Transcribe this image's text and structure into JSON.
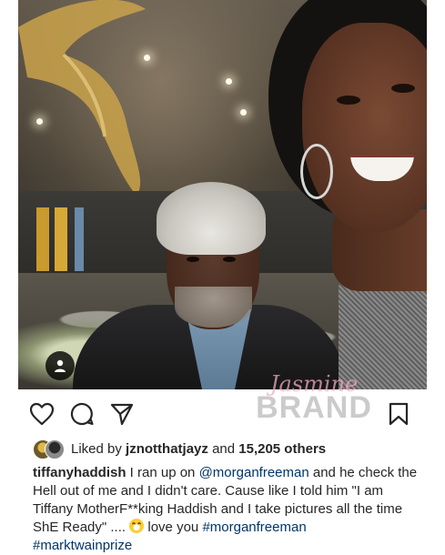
{
  "post": {
    "photo": {
      "alt": ""
    },
    "watermark": {
      "top": "Jasmine",
      "bottom": "BRAND"
    },
    "actions": {
      "like_icon": "heart-outline-icon",
      "comment_icon": "comment-bubble-icon",
      "share_icon": "paper-plane-icon",
      "save_icon": "bookmark-outline-icon"
    },
    "likes": {
      "prefix": "Liked by",
      "user": "jznotthatjayz",
      "connector": "and",
      "others": "15,205 others"
    },
    "caption": {
      "author": "tiffanyhaddish",
      "text_1": " I ran up on ",
      "mention_1": "@morganfreeman",
      "text_2": " and he check the Hell out of me and I didn't care. Cause like I told him \"I am Tiffany MotherF**king Haddish and I take pictures all the time ShE Ready\" .... ",
      "emoji": "laughing-emoji",
      "text_3": " love you ",
      "hashtag_1": "#morganfreeman",
      "hashtag_2": "#marktwainprize"
    },
    "colors": {
      "text": "#262626",
      "link": "#003569",
      "background": "#ffffff"
    }
  }
}
